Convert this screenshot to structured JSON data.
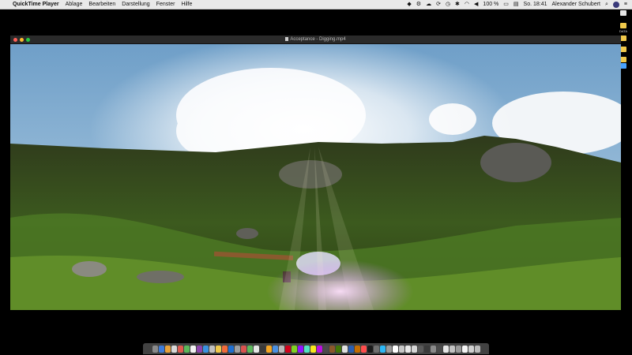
{
  "menubar": {
    "app_name": "QuickTime Player",
    "items": [
      "Ablage",
      "Bearbeiten",
      "Darstellung",
      "Fenster",
      "Hilfe"
    ],
    "battery": "100 %",
    "clock": "So. 18:41",
    "user": "Alexander Schubert"
  },
  "desktop_icons": [
    {
      "label": "",
      "color": "#e6e6e6"
    },
    {
      "label": "DATA",
      "color": "#f0c94b"
    },
    {
      "label": "",
      "color": "#f0c94b"
    },
    {
      "label": "",
      "color": "#f0c94b"
    },
    {
      "label": "",
      "color": "#f0c94b"
    },
    {
      "label": "",
      "color": "#4aa3ff"
    }
  ],
  "window": {
    "title": "Acceptance - Digging.mp4"
  },
  "dock": {
    "colors": [
      "#8a8a8a",
      "#3d7bd9",
      "#e8a23a",
      "#d8d8d8",
      "#e05a4f",
      "#5bb85b",
      "#f2f2f2",
      "#8e44ad",
      "#3a93e0",
      "#c0c0c0",
      "#f0c94b",
      "#f06a3a",
      "#1f6fd1",
      "#a0a0a0",
      "#d9534f",
      "#5cb85c",
      "#e6e6e6",
      "#3a3a3a",
      "#f5a623",
      "#4a90e2",
      "#b8b8b8",
      "#d0021b",
      "#7ed321",
      "#9013fe",
      "#50e3c2",
      "#f8e71c",
      "#bd10e0",
      "#4a4a4a",
      "#8b572a",
      "#417505",
      "#e0e0e0",
      "#2a5db0",
      "#c46c00",
      "#ff4d4d",
      "#1a1a1a",
      "#6f6f6f",
      "#2db7f5",
      "#9b9b9b",
      "#ffffff",
      "#c7c7c7",
      "#e8e8e8",
      "#d6d6d6",
      "#5a5a5a",
      "#3a3a3a",
      "#8a8a8a",
      "#4a4a4a",
      "#e6e6e6",
      "#c2c2c2",
      "#9a9a9a",
      "#f4f4f4",
      "#d0d0d0",
      "#bcbcbc"
    ]
  }
}
